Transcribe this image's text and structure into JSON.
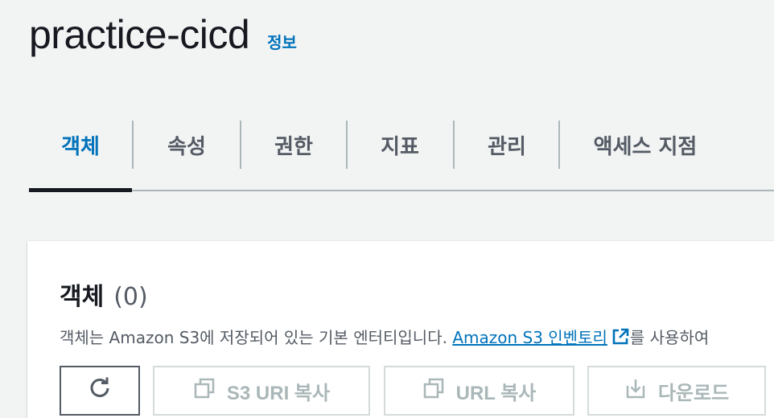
{
  "header": {
    "title": "practice-cicd",
    "info_label": "정보"
  },
  "tabs": [
    {
      "label": "객체",
      "active": true
    },
    {
      "label": "속성",
      "active": false
    },
    {
      "label": "권한",
      "active": false
    },
    {
      "label": "지표",
      "active": false
    },
    {
      "label": "관리",
      "active": false
    },
    {
      "label": "액세스 지점",
      "active": false
    }
  ],
  "objects_panel": {
    "title": "객체",
    "count": "(0)",
    "description_prefix": "객체는 Amazon S3에 저장되어 있는 기본 엔터티입니다. ",
    "inventory_link": "Amazon S3 인벤토리",
    "description_suffix": "를 사용하여"
  },
  "toolbar": {
    "refresh_icon": "refresh-icon",
    "copy_s3_uri_label": "S3 URI 복사",
    "copy_url_label": "URL 복사",
    "download_label": "다운로드"
  },
  "colors": {
    "accent": "#0073bb",
    "text": "#16191f",
    "muted": "#545b64",
    "disabled": "#aab7b8",
    "background": "#f2f3f3"
  }
}
